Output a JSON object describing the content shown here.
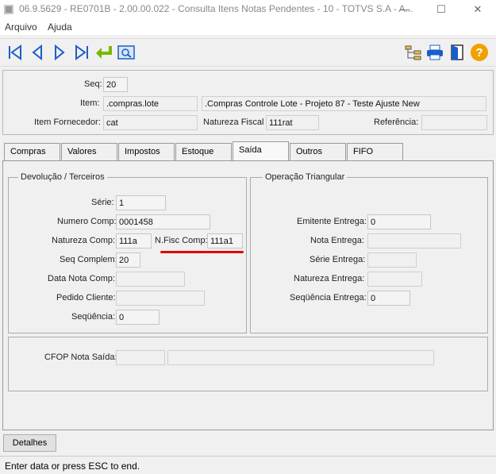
{
  "window": {
    "title": "06.9.5629 - RE0701B - 2.00.00.022 - Consulta Itens Notas Pendentes - 10 - TOTVS S.A - A...",
    "minimize": "—",
    "maximize": "☐",
    "close": "✕"
  },
  "menu": {
    "items": [
      "Arquivo",
      "Ajuda"
    ]
  },
  "header": {
    "seq_label": "Seq:",
    "seq_value": "20",
    "item_label": "Item:",
    "item_code": ".compras.lote",
    "item_desc": ".Compras Controle Lote - Projeto 87 - Teste Ajuste New",
    "fornecedor_label": "Item Fornecedor:",
    "fornecedor_value": "cat",
    "natureza_label": "Natureza Fiscal",
    "natureza_value": "111rat",
    "referencia_label": "Referência:",
    "referencia_value": ""
  },
  "tabs": [
    "Compras",
    "Valores",
    "Impostos",
    "Estoque",
    "Saída",
    "Outros",
    "FIFO"
  ],
  "devolucao": {
    "title": "Devolução / Terceiros",
    "serie_label": "Série:",
    "serie_value": "1",
    "numero_label": "Numero Comp:",
    "numero_value": "0001458",
    "natureza_label": "Natureza Comp:",
    "natureza_value": "111a",
    "nfisc_label": "N.Fisc Comp:",
    "nfisc_value": "111a1",
    "seqcomplem_label": "Seq Complem:",
    "seqcomplem_value": "20",
    "datanota_label": "Data Nota Comp:",
    "datanota_value": "",
    "pedido_label": "Pedido Cliente:",
    "pedido_value": "",
    "sequencia_label": "Seqüência:",
    "sequencia_value": "0"
  },
  "triangular": {
    "title": "Operação Triangular",
    "emitente_label": "Emitente Entrega:",
    "emitente_value": "0",
    "nota_label": "Nota Entrega:",
    "nota_value": "",
    "serie_label": "Série Entrega:",
    "serie_value": "",
    "natureza_label": "Natureza Entrega:",
    "natureza_value": "",
    "sequencia_label": "Seqüência Entrega:",
    "sequencia_value": "0"
  },
  "cfop": {
    "label": "CFOP Nota Saída:",
    "code": "",
    "desc": ""
  },
  "detalhes_label": "Detalhes",
  "status": "Enter data or press ESC to end.",
  "colors": {
    "annotation_underline": "#e00000",
    "nav_arrow": "#1a5fc8",
    "confirm_arrow": "#7ab800",
    "help": "#f0a000"
  }
}
